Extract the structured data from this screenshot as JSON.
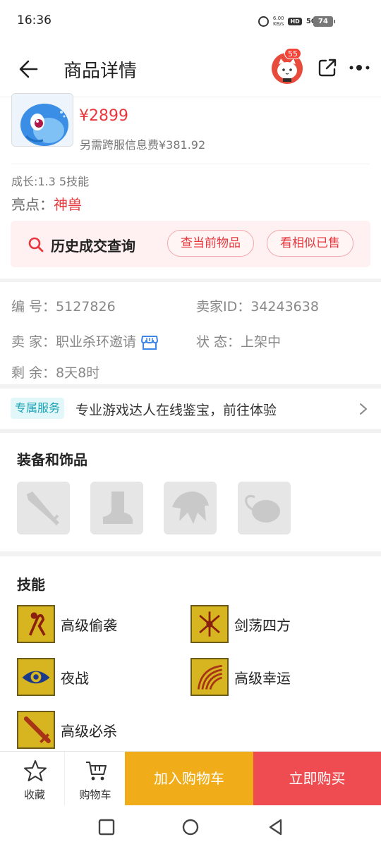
{
  "status_bar": {
    "time": "16:36",
    "net_speed_value": "6.00",
    "net_speed_unit": "KB/s",
    "hd": "HD",
    "network": "5G",
    "battery": "74"
  },
  "header": {
    "title": "商品详情",
    "notification_count": "55"
  },
  "product": {
    "price": "¥2899",
    "cross_server_fee": "另需跨服信息费¥381.92",
    "growth": "成长:1.3 5技能",
    "highlight_label": "亮点：",
    "highlight_value": "神兽"
  },
  "history": {
    "label": "历史成交查询",
    "btn_current": "查当前物品",
    "btn_similar": "看相似已售"
  },
  "info": {
    "id_label": "编 号：",
    "id_value": "5127826",
    "seller_id_label": "卖家ID：",
    "seller_id_value": "34243638",
    "seller_label": "卖 家：",
    "seller_value": "职业杀环邀请",
    "status_label": "状 态：",
    "status_value": "上架中",
    "remaining_label": "剩 余：",
    "remaining_value": "8天8时"
  },
  "service": {
    "tag": "专属服务",
    "text": "专业游戏达人在线鉴宝，前往体验"
  },
  "equipment": {
    "title": "装备和饰品",
    "slots": [
      "weapon-icon",
      "boots-icon",
      "helmet-icon",
      "accessory-icon"
    ]
  },
  "skills": {
    "title": "技能",
    "items": [
      "高级偷袭",
      "剑荡四方",
      "夜战",
      "高级幸运",
      "高级必杀"
    ]
  },
  "bottom_bar": {
    "favorite": "收藏",
    "cart": "购物车",
    "add_to_cart": "加入购物车",
    "buy_now": "立即购买"
  },
  "colors": {
    "accent_red": "#e8383d",
    "add_cart_orange": "#f0ad19",
    "buy_now_red": "#ee4c50",
    "service_teal": "#1aa3b5"
  }
}
